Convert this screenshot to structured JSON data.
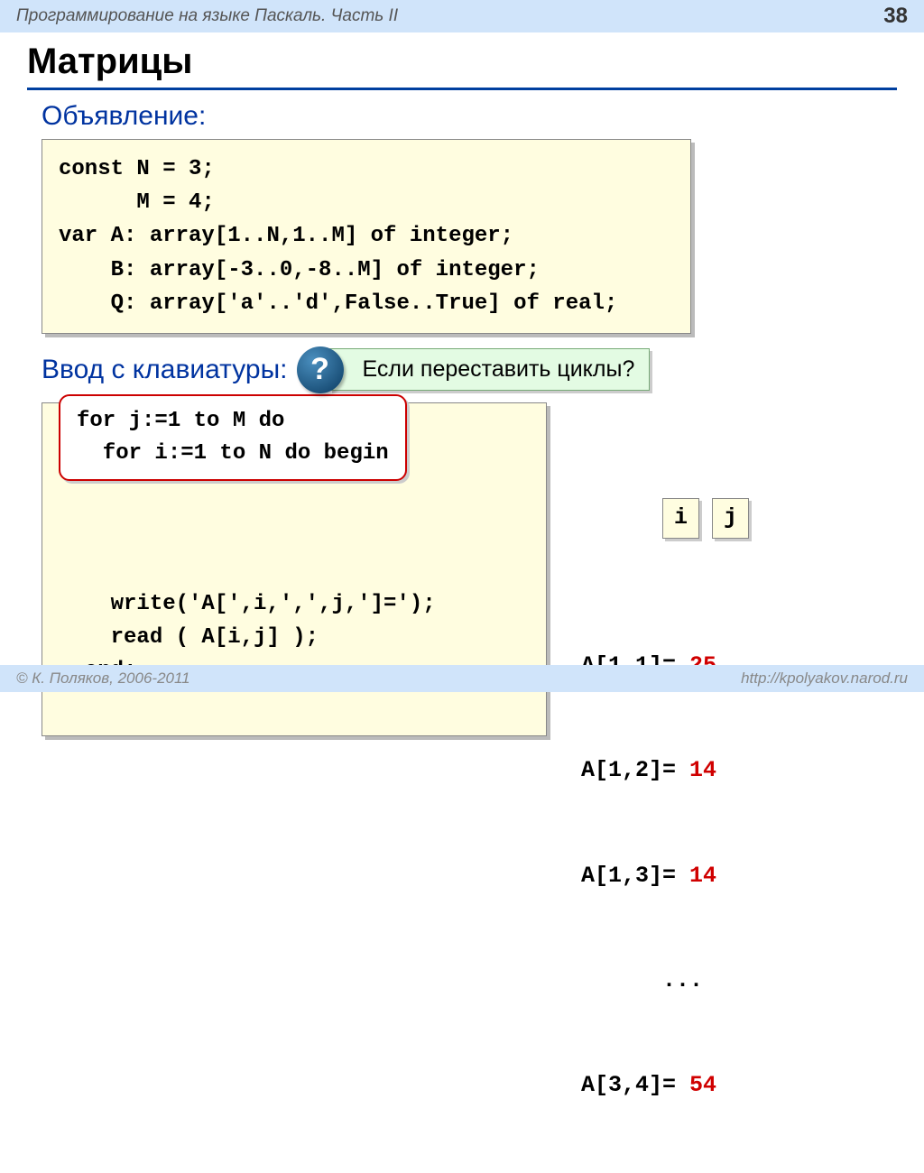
{
  "header": {
    "course": "Программирование на языке Паскаль. Часть II",
    "page": "38"
  },
  "title": "Матрицы",
  "sections": {
    "declaration": "Объявление:",
    "input": "Ввод с клавиатуры:"
  },
  "code_declaration": "const N = 3;\n      M = 4;\nvar A: array[1..N,1..M] of integer;\n    B: array[-3..0,-8..M] of integer;\n    Q: array['a'..'d',False..True] of real;",
  "question": {
    "symbol": "?",
    "text": "Если переставить циклы?"
  },
  "code_input_overlay": "for j:=1 to M do\n  for i:=1 to N do begin",
  "code_input_body": "    write('A[',i,',',j,']=');\n    read ( A[i,j] );\n  end;",
  "ij": {
    "i": "i",
    "j": "j"
  },
  "output_rows": [
    {
      "label": "A[1,1]=",
      "value": "25"
    },
    {
      "label": "A[1,2]=",
      "value": "14"
    },
    {
      "label": "A[1,3]=",
      "value": "14"
    },
    {
      "label": "      ...",
      "value": ""
    },
    {
      "label": "A[3,4]=",
      "value": "54"
    }
  ],
  "footer": {
    "copyright": "© К. Поляков, 2006-2011",
    "url": "http://kpolyakov.narod.ru"
  }
}
